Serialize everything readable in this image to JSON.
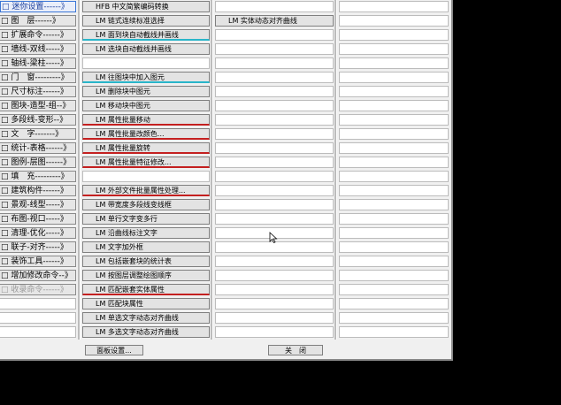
{
  "left_menu": [
    {
      "label": "□ 迷你设置------》",
      "state": "selected"
    },
    {
      "label": "□ 图　层------》",
      "state": "normal"
    },
    {
      "label": "□ 扩展命令------》",
      "state": "normal"
    },
    {
      "label": "□ 墙线-双线-----》",
      "state": "normal"
    },
    {
      "label": "□ 轴线-梁柱-----》",
      "state": "normal"
    },
    {
      "label": "□ 门　窗---------》",
      "state": "normal"
    },
    {
      "label": "□ 尺寸标注------》",
      "state": "normal"
    },
    {
      "label": "□ 图块-造型-组--》",
      "state": "normal"
    },
    {
      "label": "□ 多段线-变形--》",
      "state": "normal"
    },
    {
      "label": "□ 文　字-------》",
      "state": "normal"
    },
    {
      "label": "□ 统计-表格------》",
      "state": "normal"
    },
    {
      "label": "□ 图例-层图------》",
      "state": "normal"
    },
    {
      "label": "□ 填　充---------》",
      "state": "normal"
    },
    {
      "label": "□ 建筑构件------》",
      "state": "normal"
    },
    {
      "label": "□ 景观-线型-----》",
      "state": "normal"
    },
    {
      "label": "□ 布图-视口-----》",
      "state": "normal"
    },
    {
      "label": "□ 清理-优化-----》",
      "state": "normal"
    },
    {
      "label": "□ 联子-对齐-----》",
      "state": "normal"
    },
    {
      "label": "□ 装饰工具------》",
      "state": "normal"
    },
    {
      "label": "□ 增加修改命令--》",
      "state": "normal"
    },
    {
      "label": "□ 收录命令------》",
      "state": "dim"
    },
    {
      "label": "",
      "state": "empty"
    },
    {
      "label": "",
      "state": "empty"
    },
    {
      "label": "",
      "state": "empty"
    }
  ],
  "column1": [
    {
      "label": "HFB 中文简繁编码转换",
      "accent": ""
    },
    {
      "label": "LM 链式连续标准选择",
      "accent": ""
    },
    {
      "label": "LM 面到块自动截线并画线",
      "accent": "cyan"
    },
    {
      "label": "LM 选块自动截线并画线",
      "accent": ""
    },
    {
      "label": "",
      "accent": "empty"
    },
    {
      "label": "LM 往图块中加入图元",
      "accent": "cyan"
    },
    {
      "label": "LM 删除块中图元",
      "accent": ""
    },
    {
      "label": "LM 移动块中图元",
      "accent": ""
    },
    {
      "label": "LM 属性批量移动",
      "accent": "red"
    },
    {
      "label": "LM 属性批量改颜色...",
      "accent": "red"
    },
    {
      "label": "LM 属性批量旋转",
      "accent": "red"
    },
    {
      "label": "LM 属性批量特征修改...",
      "accent": "red"
    },
    {
      "label": "",
      "accent": "empty"
    },
    {
      "label": "LM 外部文件批量属性处理...",
      "accent": "red"
    },
    {
      "label": "LM 带宽度多段线变线框",
      "accent": ""
    },
    {
      "label": "LM 单行文字变多行",
      "accent": ""
    },
    {
      "label": "LM 沿曲线标注文字",
      "accent": ""
    },
    {
      "label": "LM 文字加外框",
      "accent": ""
    },
    {
      "label": "LM 包括嵌套块的统计表",
      "accent": ""
    },
    {
      "label": "LM 按图层调整绘图顺序",
      "accent": ""
    },
    {
      "label": "LM 匹配嵌套实体属性",
      "accent": "red"
    },
    {
      "label": "LM 匹配块属性",
      "accent": ""
    },
    {
      "label": "LM 单选文字动态对齐曲线",
      "accent": ""
    },
    {
      "label": "LM 多选文字动态对齐曲线",
      "accent": ""
    }
  ],
  "column2": [
    {
      "label": "",
      "accent": "empty"
    },
    {
      "label": "LM 实体动态对齐曲线",
      "accent": ""
    }
  ],
  "footer": {
    "panel_settings": "面板设置...",
    "close": "关　闭"
  }
}
